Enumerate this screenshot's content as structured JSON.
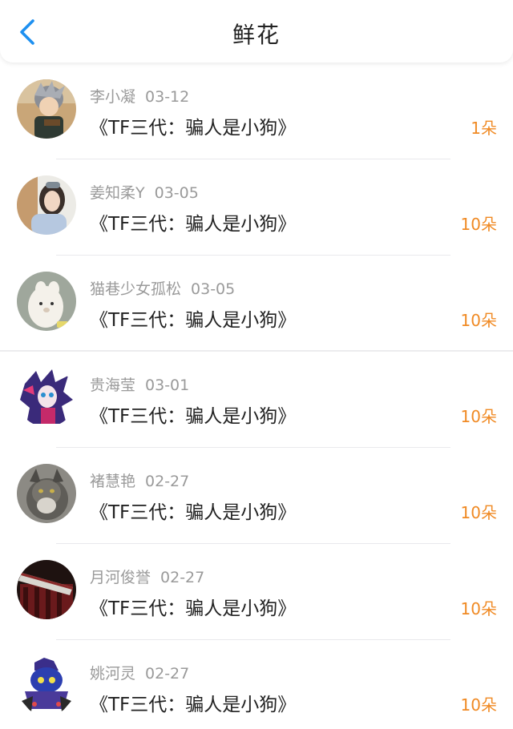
{
  "header": {
    "title": "鲜花",
    "back_icon": "chevron-left-icon",
    "accent": "#1e90f0"
  },
  "colors": {
    "count": "#f08a24",
    "meta": "#9a9a9a",
    "text": "#222222"
  },
  "items": [
    {
      "name": "李小凝",
      "date": "03-12",
      "book": "《TF三代：骗人是小狗》",
      "count": "1朵"
    },
    {
      "name": "姜知柔Y",
      "date": "03-05",
      "book": "《TF三代：骗人是小狗》",
      "count": "10朵"
    },
    {
      "name": "猫巷少女孤松",
      "date": "03-05",
      "book": "《TF三代：骗人是小狗》",
      "count": "10朵"
    },
    {
      "name": "贵海莹",
      "date": "03-01",
      "book": "《TF三代：骗人是小狗》",
      "count": "10朵"
    },
    {
      "name": "褚慧艳",
      "date": "02-27",
      "book": "《TF三代：骗人是小狗》",
      "count": "10朵"
    },
    {
      "name": "月河俊誉",
      "date": "02-27",
      "book": "《TF三代：骗人是小狗》",
      "count": "10朵"
    },
    {
      "name": "姚河灵",
      "date": "02-27",
      "book": "《TF三代：骗人是小狗》",
      "count": "10朵"
    }
  ]
}
